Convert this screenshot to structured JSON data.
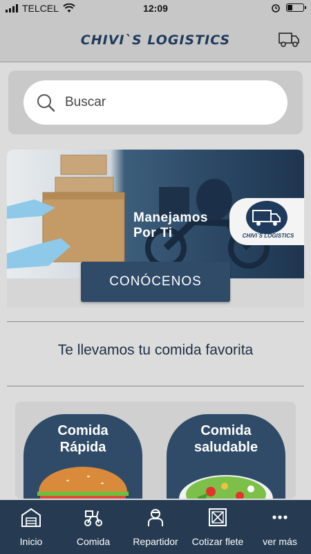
{
  "status_bar": {
    "carrier": "TELCEL",
    "time": "12:09"
  },
  "header": {
    "logo_text": "CHIVI`S LOGISTICS",
    "truck_icon": "truck-icon"
  },
  "search": {
    "placeholder": "Buscar",
    "icon": "search-icon"
  },
  "banner": {
    "slogan_line1": "Manejamos",
    "slogan_line2": "Por Ti",
    "badge_text": "CHIVI`S LOGISTICS",
    "cta_label": "CONÓCENOS"
  },
  "tagline": "Te llevamos tu comida favorita",
  "categories": [
    {
      "line1": "Comida",
      "line2": "Rápida"
    },
    {
      "line1": "Comida",
      "line2": "saludable"
    }
  ],
  "nav": [
    {
      "label": "Inicio",
      "icon": "warehouse-icon"
    },
    {
      "label": "Comida",
      "icon": "scooter-icon"
    },
    {
      "label": "Repartidor",
      "icon": "courier-icon"
    },
    {
      "label": "Cotizar flete",
      "icon": "crate-icon"
    },
    {
      "label": "ver más",
      "icon": "more-icon"
    }
  ],
  "colors": {
    "primary": "#2f4b68",
    "nav_bg": "#263b52",
    "header_bg": "#c7c7c7",
    "page_bg": "#dcdcdc"
  }
}
